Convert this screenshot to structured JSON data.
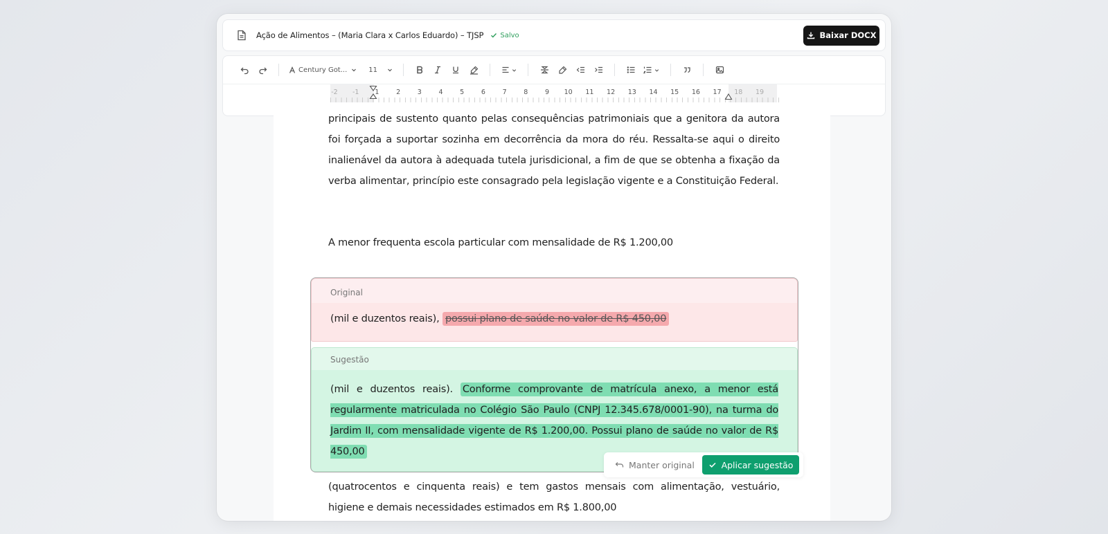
{
  "header": {
    "doc_title": "Ação de Alimentos – (Maria Clara x Carlos Eduardo) – TJSP",
    "saved_label": "Salvo",
    "download_label": "Baixar DOCX"
  },
  "toolbar": {
    "font_family": "Century Got...",
    "font_size": "11"
  },
  "ruler": {
    "labels": [
      "-2",
      "-1",
      "1",
      "2",
      "3",
      "4",
      "5",
      "6",
      "7",
      "8",
      "9",
      "10",
      "11",
      "12",
      "13",
      "14",
      "15",
      "16",
      "17",
      "18",
      "19"
    ]
  },
  "document": {
    "paragraph1": "principais de sustento quanto pelas consequências patrimoniais que a genitora da autora foi forçada a suportar sozinha em decorrência da mora do réu. Ressalta-se aqui o direito inalienável da autora à adequada tutela jurisdicional, a fim de que se obtenha a fixação da verba alimentar, princípio este consagrado pela legislação vigente e a Constituição Federal.",
    "paragraph2": "A menor frequenta escola particular com mensalidade de R$ 1.200,00",
    "paragraph3": "(quatrocentos e cinquenta reais) e tem gastos mensais com alimentação, vestuário, higiene e demais necessidades estimados em R$ 1.800,00"
  },
  "suggestion": {
    "original_header": "Original",
    "original_prefix": "(mil e duzentos reais),",
    "original_removed": "possui plano de saúde no valor de R$ 450,00",
    "suggested_header": "Sugestão",
    "suggested_prefix": "(mil e duzentos reais).",
    "suggested_added": "Conforme comprovante de matrícula anexo, a menor está regularmente matriculada no Colégio São Paulo (CNPJ 12.345.678/0001-90), na turma do Jardim II, com mensalidade vigente de R$ 1.200,00. Possui plano de saúde no valor de R$ 450,00",
    "keep_label": "Manter original",
    "apply_label": "Aplicar sugestão"
  }
}
